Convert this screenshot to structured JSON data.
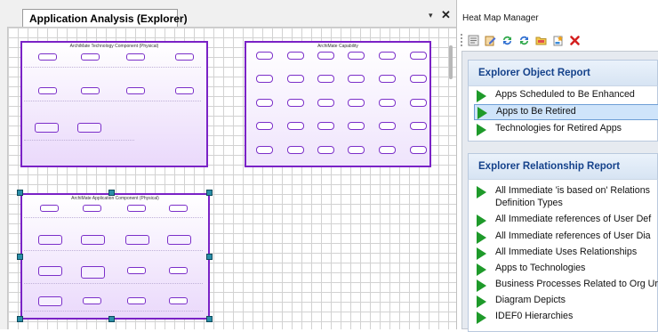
{
  "left_pane": {
    "tab_label": "Application Analysis (Explorer)",
    "dropdown_glyph": "▾",
    "close_glyph": "✕",
    "frames": {
      "tech_title": "ArchiMate Technology Component (Physical)",
      "cap_title": "ArchiMate Capability",
      "app_title": "ArchiMate Application Component (Physical)"
    }
  },
  "right_pane": {
    "title": "Heat Map Manager",
    "toolbar_icons": [
      "properties-icon",
      "edit-icon",
      "refresh-icon",
      "refresh-all-icon",
      "folder-icon",
      "new-icon",
      "delete-icon"
    ],
    "sections": [
      {
        "header": "Explorer Object Report",
        "items": [
          {
            "label": "Apps Scheduled to Be Enhanced",
            "selected": false
          },
          {
            "label": "Apps to Be Retired",
            "selected": true
          },
          {
            "label": "Technologies for Retired Apps",
            "selected": false
          }
        ]
      },
      {
        "header": "Explorer Relationship Report",
        "items": [
          {
            "label": "All Immediate 'is based on' Relations",
            "label2": "Definition Types"
          },
          {
            "label": "All Immediate references of User Def"
          },
          {
            "label": "All Immediate references of User Dia"
          },
          {
            "label": "All Immediate Uses Relationships"
          },
          {
            "label": "Apps to Technologies"
          },
          {
            "label": "Business Processes Related to Org Ur"
          },
          {
            "label": "Diagram Depicts"
          },
          {
            "label": "IDEF0 Hierarchies"
          }
        ]
      }
    ]
  },
  "colors": {
    "frame_border": "#7a22c6",
    "frame_fill": "#ead9fb",
    "selection": "#cfe4fa",
    "section_header_text": "#15428b",
    "play_icon": "#1e9a2a",
    "handle": "#2a8fa8"
  }
}
